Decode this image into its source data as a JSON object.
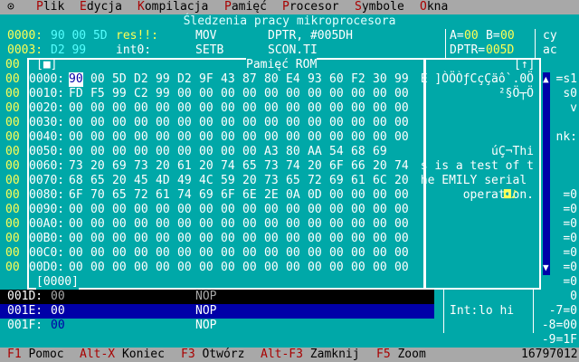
{
  "menubar": {
    "system_icon": "⊙",
    "items": [
      {
        "label": "Plik",
        "hot": "P",
        "rest": "lik"
      },
      {
        "label": "Edycja",
        "hot": "E",
        "rest": "dycja"
      },
      {
        "label": "Kompilacja",
        "hot": "K",
        "rest": "ompilacja"
      },
      {
        "label": "Pamięć",
        "hot": "P",
        "rest": "amięć"
      },
      {
        "label": "Procesor",
        "hot": "P",
        "rest": "rocesor"
      },
      {
        "label": "Symbole",
        "hot": "S",
        "rest": "ymbole"
      },
      {
        "label": "Okna",
        "hot": "O",
        "rest": "kna"
      }
    ]
  },
  "app_title": "Śledzenia pracy mikroprocesora",
  "code_top": [
    {
      "addr": "0000:",
      "bytes": "90 00 5D",
      "label": "res!!:",
      "mnem": "MOV",
      "ops": "DPTR, #005DH"
    },
    {
      "addr": "0003:",
      "bytes": "D2 99",
      "label": "int0:",
      "mnem": "SETB",
      "ops": "SCON.TI"
    }
  ],
  "registers": {
    "a_label": "A=",
    "a_val": "00",
    "b_label": "B=",
    "b_val": "00",
    "dptr_label": "DPTR=",
    "dptr_val": "005D"
  },
  "flags": [
    "cy",
    "ac"
  ],
  "memwin": {
    "title": "Pamięć ROM",
    "close_glyph": "[■]",
    "zoom_glyph": "[↑]",
    "bottom_addr": "[0000]",
    "rows": [
      {
        "addr": "0000:",
        "hex": [
          "90",
          "00",
          "5D",
          "D2",
          "99",
          "D2",
          "9F",
          "43",
          "87",
          "80",
          "E4",
          "93",
          "60",
          "F2",
          "30",
          "99"
        ],
        "ascii": "É ]ÒÖÒƒCçÇäô`.0Ö"
      },
      {
        "addr": "0010:",
        "hex": [
          "FD",
          "F5",
          "99",
          "C2",
          "99",
          "00",
          "00",
          "00",
          "00",
          "00",
          "00",
          "00",
          "00",
          "00",
          "00",
          "00"
        ],
        "ascii": "²§Ö┬Ö"
      },
      {
        "addr": "0020:",
        "hex": [
          "00",
          "00",
          "00",
          "00",
          "00",
          "00",
          "00",
          "00",
          "00",
          "00",
          "00",
          "00",
          "00",
          "00",
          "00",
          "00"
        ],
        "ascii": ""
      },
      {
        "addr": "0030:",
        "hex": [
          "00",
          "00",
          "00",
          "00",
          "00",
          "00",
          "00",
          "00",
          "00",
          "00",
          "00",
          "00",
          "00",
          "00",
          "00",
          "00"
        ],
        "ascii": ""
      },
      {
        "addr": "0040:",
        "hex": [
          "00",
          "00",
          "00",
          "00",
          "00",
          "00",
          "00",
          "00",
          "00",
          "00",
          "00",
          "00",
          "00",
          "00",
          "00",
          "00"
        ],
        "ascii": ""
      },
      {
        "addr": "0050:",
        "hex": [
          "00",
          "00",
          "00",
          "00",
          "00",
          "00",
          "00",
          "00",
          "00",
          "A3",
          "80",
          "AA",
          "54",
          "68",
          "69"
        ],
        "ascii": "úÇ¬Thi"
      },
      {
        "addr": "0060:",
        "hex": [
          "73",
          "20",
          "69",
          "73",
          "20",
          "61",
          "20",
          "74",
          "65",
          "73",
          "74",
          "20",
          "6F",
          "66",
          "20",
          "74"
        ],
        "ascii": "s is a test of t"
      },
      {
        "addr": "0070:",
        "hex": [
          "68",
          "65",
          "20",
          "45",
          "4D",
          "49",
          "4C",
          "59",
          "20",
          "73",
          "65",
          "72",
          "69",
          "61",
          "6C",
          "20"
        ],
        "ascii": "he EMILY serial "
      },
      {
        "addr": "0080:",
        "hex": [
          "6F",
          "70",
          "65",
          "72",
          "61",
          "74",
          "69",
          "6F",
          "6E",
          "2E",
          "0A",
          "0D",
          "00",
          "00",
          "00",
          "00"
        ],
        "ascii": "operation."
      },
      {
        "addr": "0090:",
        "hex": [
          "00",
          "00",
          "00",
          "00",
          "00",
          "00",
          "00",
          "00",
          "00",
          "00",
          "00",
          "00",
          "00",
          "00",
          "00",
          "00"
        ],
        "ascii": ""
      },
      {
        "addr": "00A0:",
        "hex": [
          "00",
          "00",
          "00",
          "00",
          "00",
          "00",
          "00",
          "00",
          "00",
          "00",
          "00",
          "00",
          "00",
          "00",
          "00",
          "00"
        ],
        "ascii": ""
      },
      {
        "addr": "00B0:",
        "hex": [
          "00",
          "00",
          "00",
          "00",
          "00",
          "00",
          "00",
          "00",
          "00",
          "00",
          "00",
          "00",
          "00",
          "00",
          "00",
          "00"
        ],
        "ascii": ""
      },
      {
        "addr": "00C0:",
        "hex": [
          "00",
          "00",
          "00",
          "00",
          "00",
          "00",
          "00",
          "00",
          "00",
          "00",
          "00",
          "00",
          "00",
          "00",
          "00",
          "00"
        ],
        "ascii": ""
      },
      {
        "addr": "00D0:",
        "hex": [
          "00",
          "00",
          "00",
          "00",
          "00",
          "00",
          "00",
          "00",
          "00",
          "00",
          "00",
          "00",
          "00",
          "00",
          "00",
          "00"
        ],
        "ascii": ""
      }
    ],
    "ascii_tail": "◘♪"
  },
  "left_gutter": [
    "00",
    "00",
    "00",
    "00",
    "00",
    "00",
    "00",
    "00",
    "00",
    "00",
    "00",
    "00",
    "00",
    "00",
    "00"
  ],
  "code_bottom": [
    {
      "addr": "001D:",
      "bytes": "00",
      "mnem": "NOP"
    },
    {
      "addr": "001E:",
      "bytes": "00",
      "mnem": "NOP"
    },
    {
      "addr": "001F:",
      "bytes": "00",
      "mnem": "NOP"
    }
  ],
  "int_panel": {
    "label": "Int:",
    "value": "lo hi"
  },
  "right_side": [
    "=s1",
    "s0",
    "v",
    "",
    "nk:",
    "",
    "",
    "",
    "=0",
    "=0",
    "=0",
    "=0",
    "=0",
    "=0",
    "=0",
    "0",
    "-7=0",
    "-8=00",
    "-9=1F"
  ],
  "status": {
    "items": [
      {
        "key": "F1",
        "label": "Pomoc"
      },
      {
        "key": "Alt-X",
        "label": "Koniec"
      },
      {
        "key": "F3",
        "label": "Otwórz"
      },
      {
        "key": "Alt-F3",
        "label": "Zamknij"
      },
      {
        "key": "F5",
        "label": "Zoom"
      }
    ],
    "memory": "16797012"
  },
  "colors": {
    "bg": "#00a8a8",
    "menu": "#a8a8a8",
    "hotkey": "#a80000",
    "selection": "#0000a8",
    "accent": "#ffff55"
  }
}
